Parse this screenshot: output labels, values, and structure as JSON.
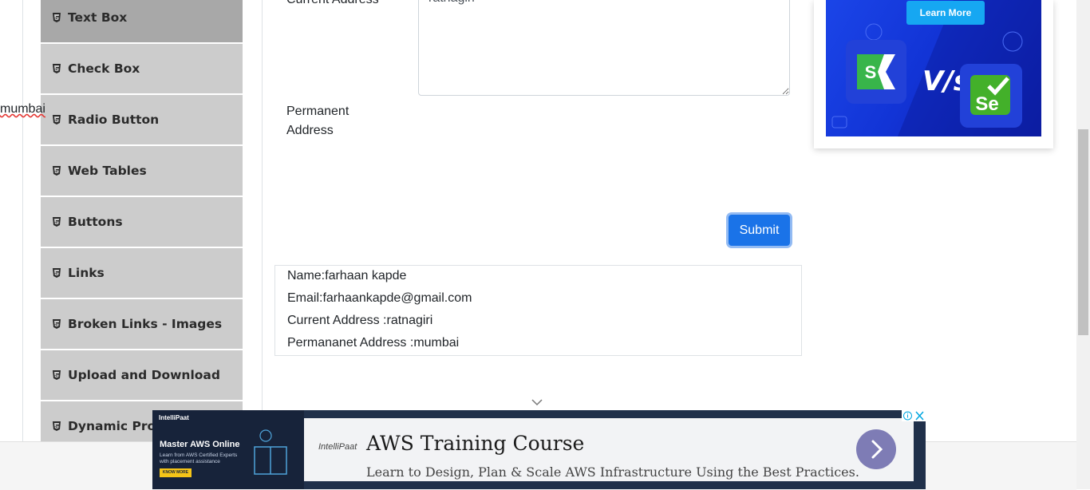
{
  "sidebar": {
    "items": [
      {
        "label": "Text Box",
        "active": true
      },
      {
        "label": "Check Box"
      },
      {
        "label": "Radio Button"
      },
      {
        "label": "Web Tables"
      },
      {
        "label": "Buttons"
      },
      {
        "label": "Links"
      },
      {
        "label": "Broken Links - Images"
      },
      {
        "label": "Upload and Download"
      },
      {
        "label": "Dynamic Properties"
      }
    ],
    "item_icon": "html5-icon"
  },
  "form": {
    "current_address_label": "Current Address",
    "current_address_value": "ratnagiri",
    "permanent_address_label_1": "Permanent",
    "permanent_address_label_2": "Address",
    "permanent_address_value": "mumbai",
    "submit_label": "Submit"
  },
  "output": {
    "name": "Name:farhaan kapde",
    "email": "Email:farhaankapde@gmail.com",
    "current_address": "Current Address :ratnagiri",
    "permanent_address": "Permananet Address :mumbai"
  },
  "side_ad": {
    "button_label": "Learn More",
    "vs_text": "V/s",
    "left_logo_letter": "S",
    "right_logo_letters": "Se"
  },
  "bottom_ad": {
    "brand": "IntelliPaat",
    "left_title": "Master AWS Online",
    "left_subtitle": "Learn from AWS Certified Experts with placement assistance",
    "left_button": "KNOW MORE",
    "title": "AWS Training Course",
    "subtitle": "Learn to Design, Plan & Scale AWS Infrastructure Using the Best Practices."
  },
  "colors": {
    "sidebar_bg": "#cccccc",
    "sidebar_active_bg": "#a8a8a8",
    "submit_bg": "#1a73e8",
    "ad_blue": "#1234d6"
  }
}
